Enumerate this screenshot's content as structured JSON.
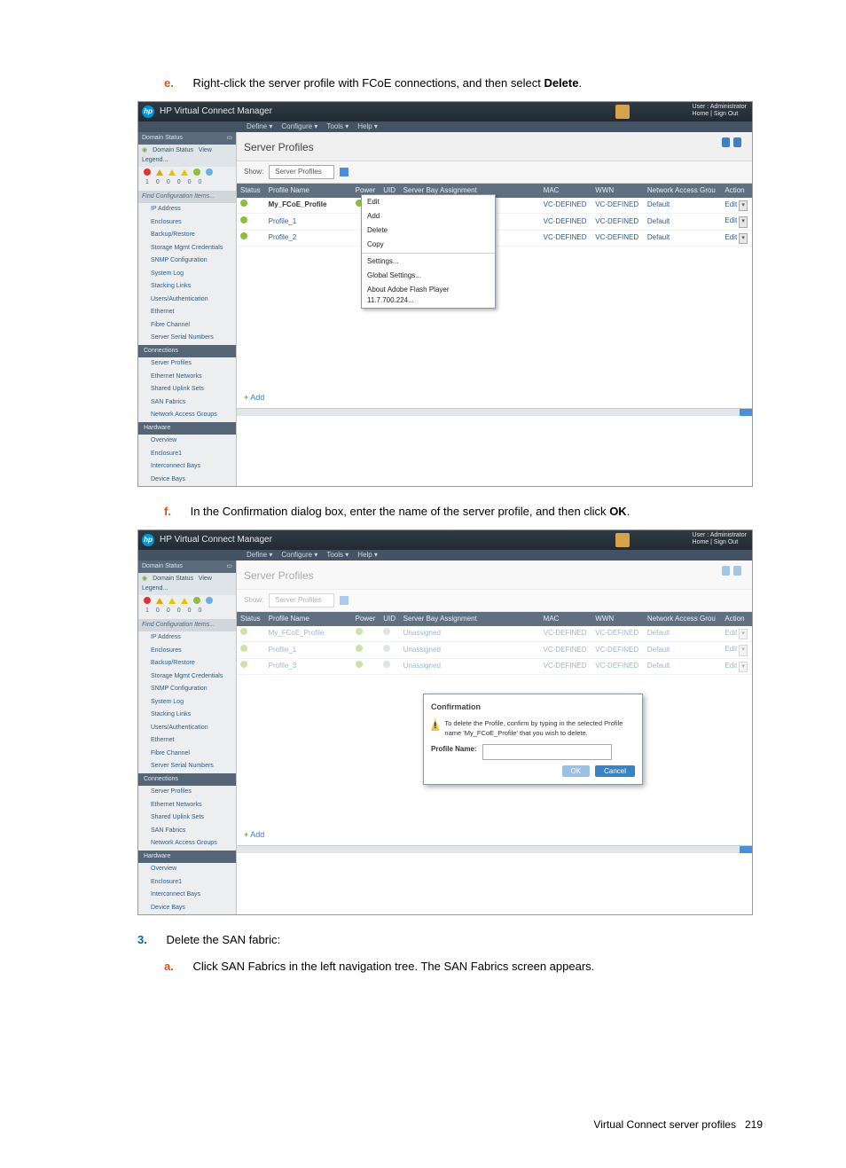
{
  "steps": {
    "e_marker": "e.",
    "e_text_before": "Right-click the server profile with FCoE connections, and then select ",
    "e_bold": "Delete",
    "e_text_after": ".",
    "f_marker": "f.",
    "f_text_before": "In the Confirmation dialog box, enter the name of the server profile, and then click ",
    "f_bold": "OK",
    "f_text_after": ".",
    "s3_marker": "3.",
    "s3_text": "Delete the SAN fabric:",
    "a_marker": "a.",
    "a_text": "Click SAN Fabrics in the left navigation tree. The SAN Fabrics screen appears."
  },
  "app": {
    "title": "HP Virtual Connect Manager",
    "user_label": "User : Administrator",
    "user_links": "Home | Sign Out",
    "menu": [
      "Define ▾",
      "Configure ▾",
      "Tools ▾",
      "Help ▾"
    ]
  },
  "left": {
    "domain_status": "Domain Status",
    "domain_status_link": "Domain Status",
    "view_legend": "View Legend...",
    "counts": [
      "1",
      "0",
      "0",
      "0",
      "0",
      "0"
    ],
    "find": "Find Configuration Items...",
    "items1": [
      "IP Address",
      "Enclosures",
      "Backup/Restore",
      "Storage Mgmt Credentials",
      "SNMP Configuration",
      "System Log",
      "Stacking Links",
      "Users/Authentication",
      "Ethernet",
      "Fibre Channel",
      "Server Serial Numbers"
    ],
    "connections_hdr": "Connections",
    "items2": [
      "Server Profiles",
      "Ethernet Networks",
      "Shared Uplink Sets",
      "SAN Fabrics",
      "Network Access Groups"
    ],
    "hardware_hdr": "Hardware",
    "items3": [
      "Overview",
      "Enclosure1",
      "Interconnect Bays",
      "Device Bays"
    ]
  },
  "main": {
    "title": "Server Profiles",
    "show_label": "Show:",
    "show_value": "Server Profiles",
    "columns": [
      "Status",
      "Profile Name",
      "Power",
      "UID",
      "Server Bay Assignment",
      "MAC",
      "WWN",
      "Network Access Grou",
      "Action"
    ],
    "rows": [
      {
        "name": "My_FCoE_Profile",
        "assign": "Unassigned",
        "mac": "VC-DEFINED",
        "wwn": "VC-DEFINED",
        "nag": "Default",
        "action": "Edit"
      },
      {
        "name": "Profile_1",
        "assign": "",
        "mac": "VC-DEFINED",
        "wwn": "VC-DEFINED",
        "nag": "Default",
        "action": "Edit"
      },
      {
        "name": "Profile_2",
        "assign": "",
        "mac": "VC-DEFINED",
        "wwn": "VC-DEFINED",
        "nag": "Default",
        "action": "Edit"
      }
    ],
    "rows2": [
      {
        "name": "My_FCoE_Profile",
        "assign": "Unassigned",
        "mac": "VC-DEFINED",
        "wwn": "VC-DEFINED",
        "nag": "Default",
        "action": "Edit"
      },
      {
        "name": "Profile_1",
        "assign": "Unassigned",
        "mac": "VC-DEFINED",
        "wwn": "VC-DEFINED",
        "nag": "Default",
        "action": "Edit"
      },
      {
        "name": "Profile_3",
        "assign": "Unassigned",
        "mac": "VC-DEFINED",
        "wwn": "VC-DEFINED",
        "nag": "Default",
        "action": "Edit"
      }
    ],
    "add": "Add"
  },
  "context": {
    "items_top": [
      "Edit",
      "Add",
      "Delete",
      "Copy"
    ],
    "items_bottom": [
      "Settings...",
      "Global Settings...",
      "About Adobe Flash Player 11.7.700.224..."
    ]
  },
  "dialog": {
    "title": "Confirmation",
    "text": "To delete the Profile, confirm by typing in the selected Profile name 'My_FCoE_Profile' that you wish to delete.",
    "profile_label": "Profile Name:",
    "ok": "OK",
    "cancel": "Cancel"
  },
  "footer": {
    "text": "Virtual Connect server profiles",
    "page": "219"
  }
}
